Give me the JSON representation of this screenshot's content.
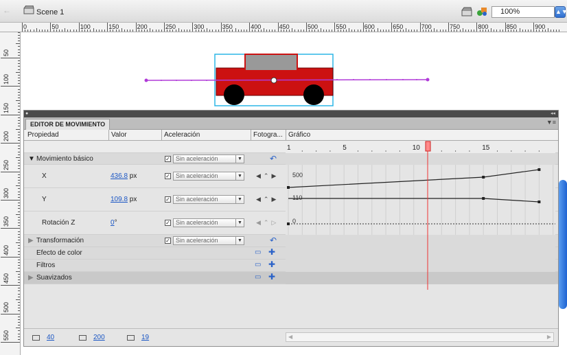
{
  "toolbar": {
    "scene_label": "Scene 1",
    "zoom_value": "100%"
  },
  "ruler": {
    "h_labels": [
      "0",
      "50",
      "100",
      "150",
      "200",
      "250",
      "300",
      "350",
      "400",
      "450",
      "500",
      "550",
      "600",
      "650",
      "700",
      "750",
      "800",
      "850",
      "900"
    ],
    "v_labels": [
      "50",
      "100",
      "150",
      "200",
      "250",
      "300",
      "350",
      "400",
      "450",
      "500",
      "550"
    ]
  },
  "panel": {
    "tab": "EDITOR DE MOVIMIENTO",
    "columns": {
      "property": "Propiedad",
      "value": "Valor",
      "easing": "Aceleración",
      "keyframe": "Fotogra...",
      "graph": "Gráfico"
    },
    "frame_ruler": [
      "1",
      "5",
      "10",
      "15"
    ],
    "current_frame": 11,
    "rows": [
      {
        "label": "Movimiento básico",
        "easing": "Sin aceleración",
        "checked": true,
        "group": true,
        "expanded": true
      },
      {
        "label": "X",
        "value": "436.8",
        "unit": " px",
        "easing": "Sin aceleración",
        "checked": true,
        "graph_max": "500"
      },
      {
        "label": "Y",
        "value": "109.8",
        "unit": " px",
        "easing": "Sin aceleración",
        "checked": true,
        "graph_max": "110"
      },
      {
        "label": "Rotación Z",
        "value": "0",
        "unit": "°",
        "easing": "Sin aceleración",
        "checked": true,
        "graph_max": "0"
      },
      {
        "label": "Transformación",
        "easing": "Sin aceleración",
        "checked": true,
        "group": true,
        "expanded": false
      },
      {
        "label": "Efecto de color"
      },
      {
        "label": "Filtros"
      },
      {
        "label": "Suavizados",
        "group": true,
        "expanded": false
      }
    ],
    "footer": {
      "graph_size": "40",
      "expanded_graph_size": "200",
      "visible_frames": "19"
    }
  }
}
